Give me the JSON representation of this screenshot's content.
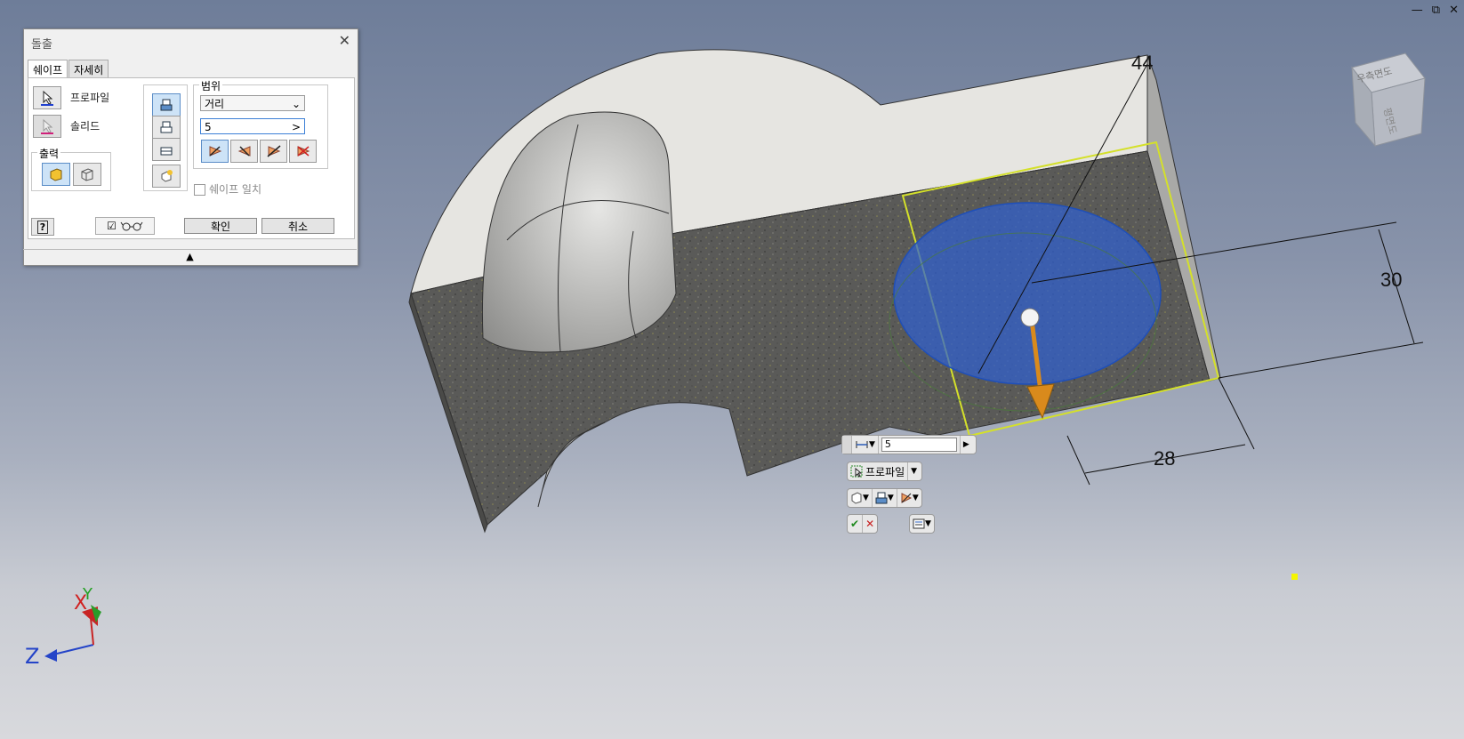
{
  "window": {
    "minimize": "—",
    "restore": "⧉",
    "close": "✕"
  },
  "dialog": {
    "title": "돌출",
    "tabs": [
      "쉐이프",
      "자세히"
    ],
    "profile_label": "프로파일",
    "solid_label": "솔리드",
    "output_group": "출력",
    "extents_group": "범위",
    "extent_type": "거리",
    "distance_value": "5",
    "match_shape_label": "쉐이프 일치",
    "ok_label": "확인",
    "cancel_label": "취소",
    "collapse": "▲"
  },
  "minitoolbar": {
    "distance_value": "5",
    "profile_label": "프로파일"
  },
  "dimensions": {
    "d44": "44",
    "d30": "30",
    "d28": "28"
  },
  "viewcube": {
    "top": "우측면도",
    "front": "평면도"
  },
  "triad": {
    "x": "X",
    "y": "Y",
    "z": "Z"
  },
  "colors": {
    "accent": "#3c7fd6",
    "extrude_arrow": "#d98a1c",
    "profile_fill": "#2f5fd0"
  }
}
